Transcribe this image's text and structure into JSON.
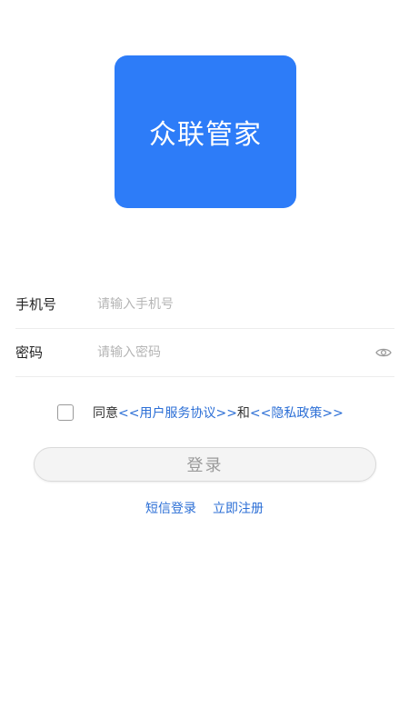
{
  "logo": {
    "text": "众联管家",
    "bg_color": "#2d7cf8"
  },
  "form": {
    "phone": {
      "label": "手机号",
      "placeholder": "请输入手机号",
      "value": ""
    },
    "password": {
      "label": "密码",
      "placeholder": "请输入密码",
      "value": "",
      "toggle_icon": "eye-icon"
    }
  },
  "agreement": {
    "checked": false,
    "prefix": "同意",
    "user_agreement": "<<用户服务协议>>",
    "conjunction": "和",
    "privacy_policy": "<<隐私政策>>"
  },
  "login_button": {
    "label": "登录"
  },
  "links": {
    "sms_login": "短信登录",
    "register": "立即注册"
  },
  "colors": {
    "link": "#2c6fd6",
    "brand": "#2d7cf8"
  }
}
